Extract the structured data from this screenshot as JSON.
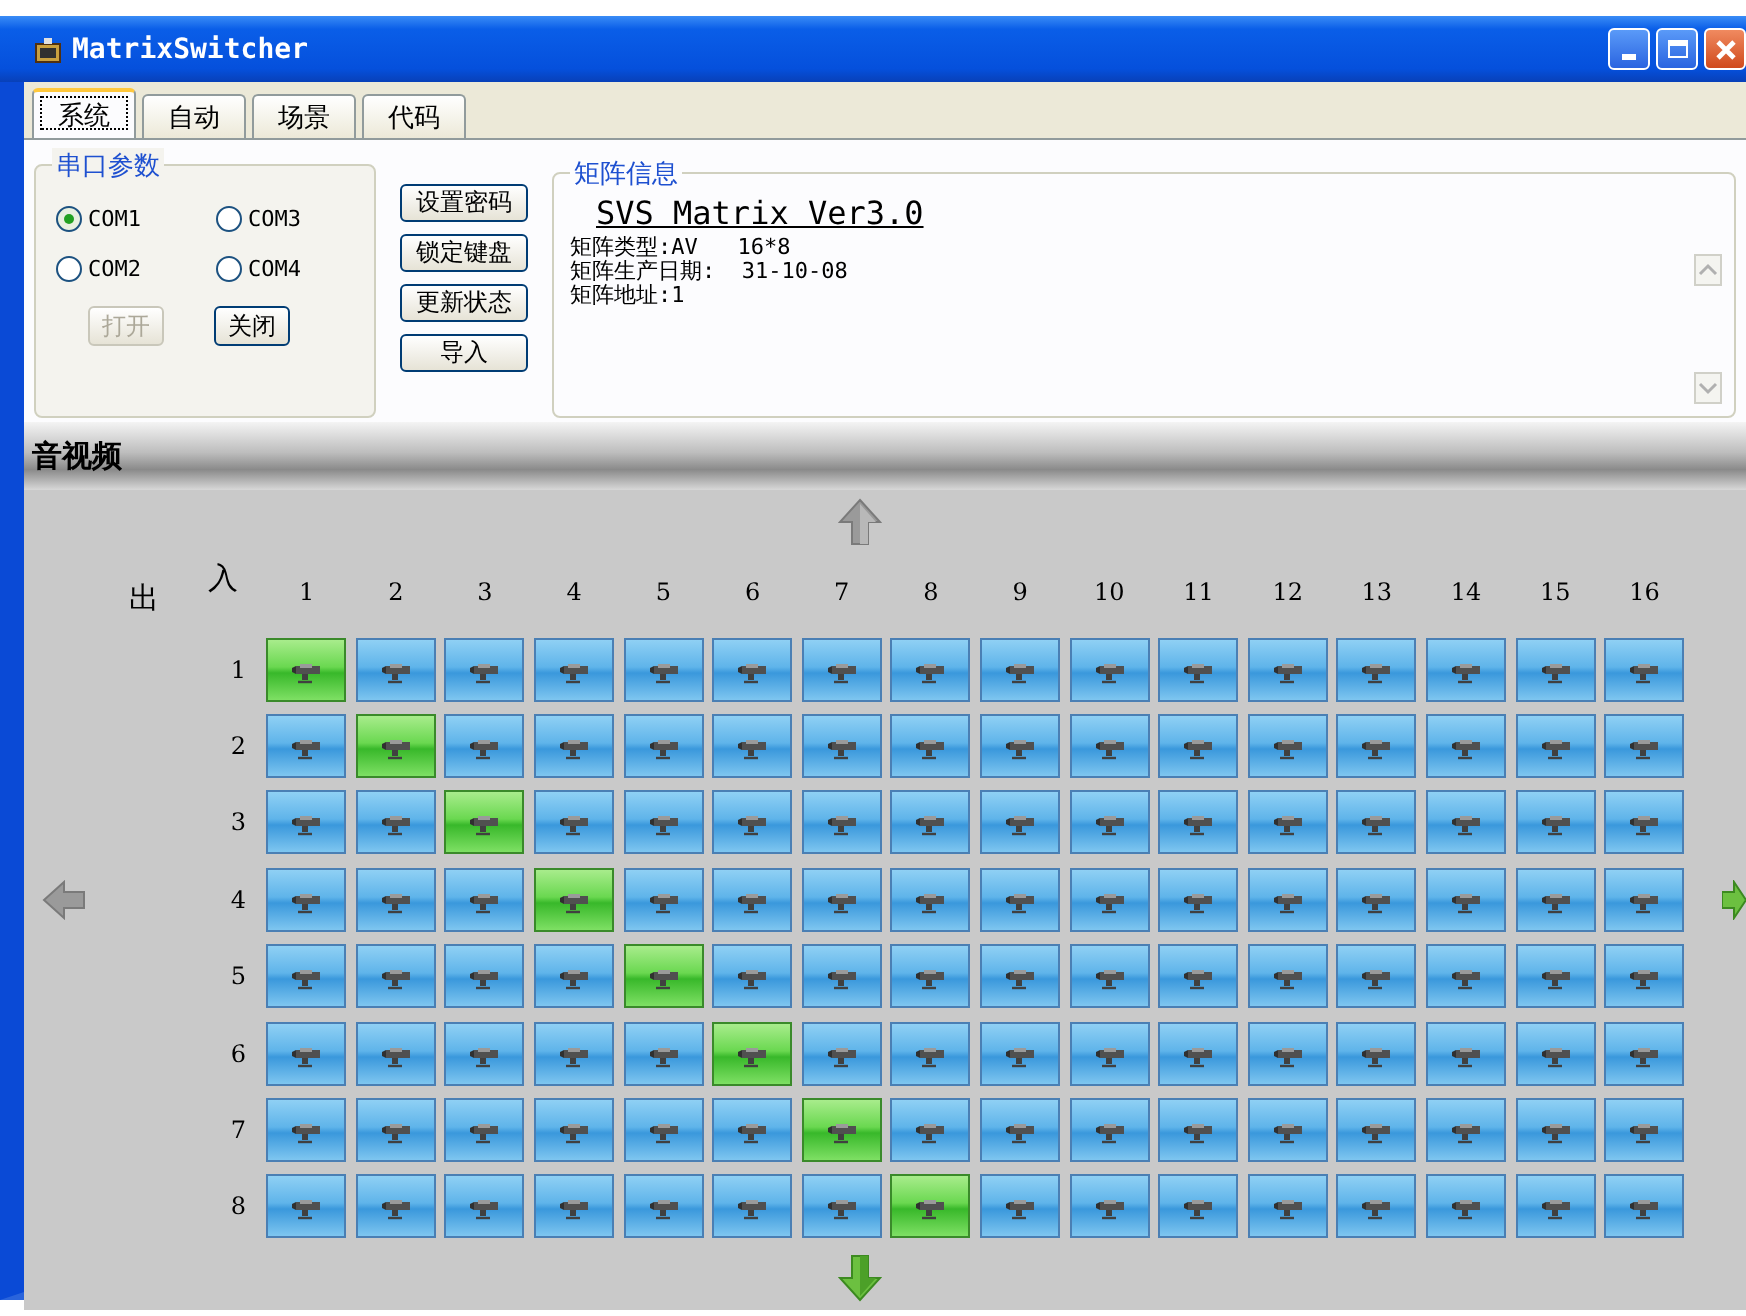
{
  "window": {
    "title": "MatrixSwitcher"
  },
  "tabs": [
    {
      "label": "系统",
      "selected": true
    },
    {
      "label": "自动",
      "selected": false
    },
    {
      "label": "场景",
      "selected": false
    },
    {
      "label": "代码",
      "selected": false
    }
  ],
  "serial_port": {
    "title": "串口参数",
    "ports": [
      {
        "label": "COM1",
        "selected": true
      },
      {
        "label": "COM3",
        "selected": false
      },
      {
        "label": "COM2",
        "selected": false
      },
      {
        "label": "COM4",
        "selected": false
      }
    ],
    "buttons": [
      {
        "label": "打开",
        "disabled": true
      },
      {
        "label": "关闭",
        "disabled": false
      }
    ]
  },
  "actions": [
    "设置密码",
    "锁定键盘",
    "更新状态",
    "导入"
  ],
  "matrix_info": {
    "title": "矩阵信息",
    "heading": "SVS Matrix Ver3.0",
    "lines": [
      "矩阵类型:AV   16*8",
      "矩阵生产日期:  31-10-08",
      "矩阵地址:1"
    ]
  },
  "section": {
    "title": "音视频"
  },
  "matrix": {
    "output_label": "出",
    "input_label": "入",
    "inputs": [
      "1",
      "2",
      "3",
      "4",
      "5",
      "6",
      "7",
      "8",
      "9",
      "10",
      "11",
      "12",
      "13",
      "14",
      "15",
      "16"
    ],
    "outputs": [
      {
        "label": "1",
        "cells": [
          {
            "selected": true
          },
          {
            "selected": false
          },
          {
            "selected": false
          },
          {
            "selected": false
          },
          {
            "selected": false
          },
          {
            "selected": false
          },
          {
            "selected": false
          },
          {
            "selected": false
          },
          {
            "selected": false
          },
          {
            "selected": false
          },
          {
            "selected": false
          },
          {
            "selected": false
          },
          {
            "selected": false
          },
          {
            "selected": false
          },
          {
            "selected": false
          },
          {
            "selected": false
          }
        ]
      },
      {
        "label": "2",
        "cells": [
          {
            "selected": false
          },
          {
            "selected": true
          },
          {
            "selected": false
          },
          {
            "selected": false
          },
          {
            "selected": false
          },
          {
            "selected": false
          },
          {
            "selected": false
          },
          {
            "selected": false
          },
          {
            "selected": false
          },
          {
            "selected": false
          },
          {
            "selected": false
          },
          {
            "selected": false
          },
          {
            "selected": false
          },
          {
            "selected": false
          },
          {
            "selected": false
          },
          {
            "selected": false
          }
        ]
      },
      {
        "label": "3",
        "cells": [
          {
            "selected": false
          },
          {
            "selected": false
          },
          {
            "selected": true
          },
          {
            "selected": false
          },
          {
            "selected": false
          },
          {
            "selected": false
          },
          {
            "selected": false
          },
          {
            "selected": false
          },
          {
            "selected": false
          },
          {
            "selected": false
          },
          {
            "selected": false
          },
          {
            "selected": false
          },
          {
            "selected": false
          },
          {
            "selected": false
          },
          {
            "selected": false
          },
          {
            "selected": false
          }
        ]
      },
      {
        "label": "4",
        "cells": [
          {
            "selected": false
          },
          {
            "selected": false
          },
          {
            "selected": false
          },
          {
            "selected": true
          },
          {
            "selected": false
          },
          {
            "selected": false
          },
          {
            "selected": false
          },
          {
            "selected": false
          },
          {
            "selected": false
          },
          {
            "selected": false
          },
          {
            "selected": false
          },
          {
            "selected": false
          },
          {
            "selected": false
          },
          {
            "selected": false
          },
          {
            "selected": false
          },
          {
            "selected": false
          }
        ]
      },
      {
        "label": "5",
        "cells": [
          {
            "selected": false
          },
          {
            "selected": false
          },
          {
            "selected": false
          },
          {
            "selected": false
          },
          {
            "selected": true
          },
          {
            "selected": false
          },
          {
            "selected": false
          },
          {
            "selected": false
          },
          {
            "selected": false
          },
          {
            "selected": false
          },
          {
            "selected": false
          },
          {
            "selected": false
          },
          {
            "selected": false
          },
          {
            "selected": false
          },
          {
            "selected": false
          },
          {
            "selected": false
          }
        ]
      },
      {
        "label": "6",
        "cells": [
          {
            "selected": false
          },
          {
            "selected": false
          },
          {
            "selected": false
          },
          {
            "selected": false
          },
          {
            "selected": false
          },
          {
            "selected": true
          },
          {
            "selected": false
          },
          {
            "selected": false
          },
          {
            "selected": false
          },
          {
            "selected": false
          },
          {
            "selected": false
          },
          {
            "selected": false
          },
          {
            "selected": false
          },
          {
            "selected": false
          },
          {
            "selected": false
          },
          {
            "selected": false
          }
        ]
      },
      {
        "label": "7",
        "cells": [
          {
            "selected": false
          },
          {
            "selected": false
          },
          {
            "selected": false
          },
          {
            "selected": false
          },
          {
            "selected": false
          },
          {
            "selected": false
          },
          {
            "selected": true
          },
          {
            "selected": false
          },
          {
            "selected": false
          },
          {
            "selected": false
          },
          {
            "selected": false
          },
          {
            "selected": false
          },
          {
            "selected": false
          },
          {
            "selected": false
          },
          {
            "selected": false
          },
          {
            "selected": false
          }
        ]
      },
      {
        "label": "8",
        "cells": [
          {
            "selected": false
          },
          {
            "selected": false
          },
          {
            "selected": false
          },
          {
            "selected": false
          },
          {
            "selected": false
          },
          {
            "selected": false
          },
          {
            "selected": false
          },
          {
            "selected": true
          },
          {
            "selected": false
          },
          {
            "selected": false
          },
          {
            "selected": false
          },
          {
            "selected": false
          },
          {
            "selected": false
          },
          {
            "selected": false
          },
          {
            "selected": false
          },
          {
            "selected": false
          }
        ]
      }
    ]
  }
}
